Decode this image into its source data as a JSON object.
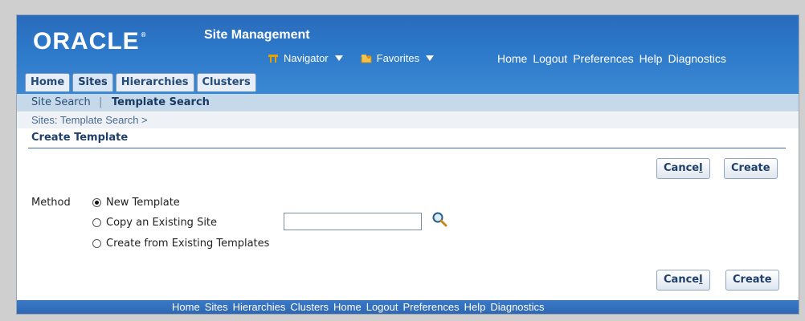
{
  "header": {
    "logo_text": "ORACLE",
    "logo_mark": "®",
    "app_title": "Site Management",
    "navigator_label": "Navigator",
    "favorites_label": "Favorites",
    "global_links": [
      "Home",
      "Logout",
      "Preferences",
      "Help",
      "Diagnostics"
    ]
  },
  "tabs": [
    {
      "label": "Home"
    },
    {
      "label": "Sites"
    },
    {
      "label": "Hierarchies"
    },
    {
      "label": "Clusters"
    }
  ],
  "subtabs": {
    "site_search": "Site Search",
    "separator": "|",
    "template_search": "Template Search"
  },
  "breadcrumb": "Sites: Template Search  >",
  "page_title": "Create Template",
  "buttons": {
    "cancel_prefix": "Cance",
    "cancel_access": "l",
    "create": "Create"
  },
  "form": {
    "method_label": "Method",
    "options": [
      "New Template",
      "Copy an Existing Site",
      "Create from Existing Templates"
    ],
    "selected_option": "New Template",
    "site_value": ""
  },
  "footer_links": [
    "Home",
    "Sites",
    "Hierarchies",
    "Clusters",
    "Home",
    "Logout",
    "Preferences",
    "Help",
    "Diagnostics"
  ],
  "colors": {
    "header_blue": "#2d79c9",
    "tab_text": "#244b7a",
    "subtab_bg": "#c6d9ea",
    "footer_blue": "#2e68b4"
  }
}
